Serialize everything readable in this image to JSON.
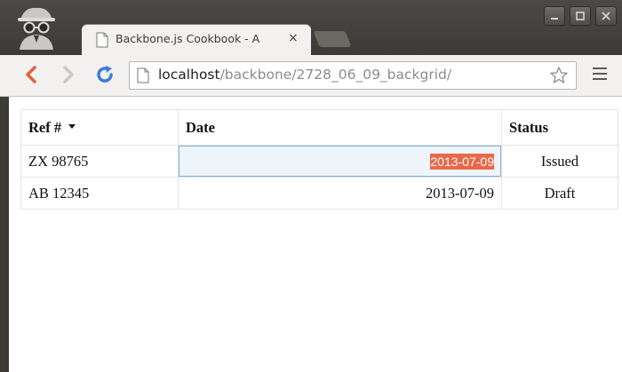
{
  "browser": {
    "tab": {
      "title": "Backbone.js Cookbook - A",
      "close_glyph": "×"
    },
    "address_bar": {
      "host": "localhost",
      "path": "/backbone/2728_06_09_backgrid/"
    },
    "icons": {
      "incognito": "incognito-icon",
      "back": "back-arrow-icon",
      "forward": "forward-arrow-icon",
      "reload": "reload-icon",
      "star": "bookmark-star-icon",
      "menu": "hamburger-menu-icon"
    },
    "colors": {
      "titlebar": "#3c3b37",
      "toolbar": "#f2f1ef",
      "back_arrow": "#e0623a",
      "reload": "#3b7cd9",
      "selection": "#e8694a",
      "editing_border": "#7ab2de"
    }
  },
  "grid": {
    "columns": [
      {
        "label": "Ref #",
        "sorted": "desc"
      },
      {
        "label": "Date"
      },
      {
        "label": "Status"
      }
    ],
    "rows": [
      {
        "ref": "ZX 98765",
        "date": "2013-07-09",
        "status": "Issued",
        "date_editing": true
      },
      {
        "ref": "AB 12345",
        "date": "2013-07-09",
        "status": "Draft",
        "date_editing": false
      }
    ]
  }
}
